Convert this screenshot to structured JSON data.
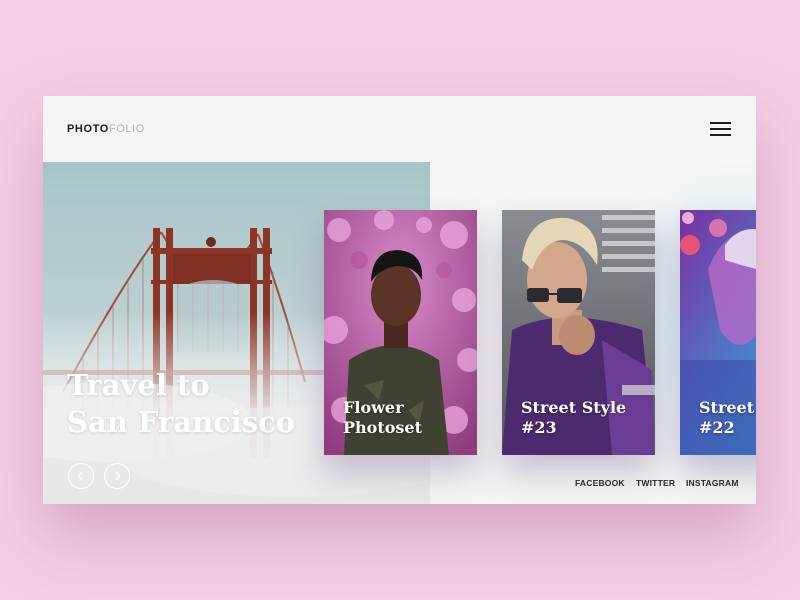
{
  "brand": {
    "part1": "PHOTO",
    "part2": "FOLIO"
  },
  "menu": {
    "icon": "hamburger-menu-icon"
  },
  "hero": {
    "title_line1": "Travel to",
    "title_line2": "San Francisco",
    "prev_icon": "chevron-left-icon",
    "next_icon": "chevron-right-icon"
  },
  "cards": [
    {
      "title_line1": "Flower",
      "title_line2": "Photoset"
    },
    {
      "title_line1": "Street Style",
      "title_line2": "#23"
    },
    {
      "title_line1": "Street Style",
      "title_line2": "#22"
    }
  ],
  "social": {
    "facebook": "FACEBOOK",
    "twitter": "TWITTER",
    "instagram": "INSTAGRAM"
  },
  "colors": {
    "page_background": "#f6cfe4",
    "panel_background": "#f5f5f5",
    "text_dark": "#1c1c1c",
    "brand_muted": "#b5b5b5"
  }
}
